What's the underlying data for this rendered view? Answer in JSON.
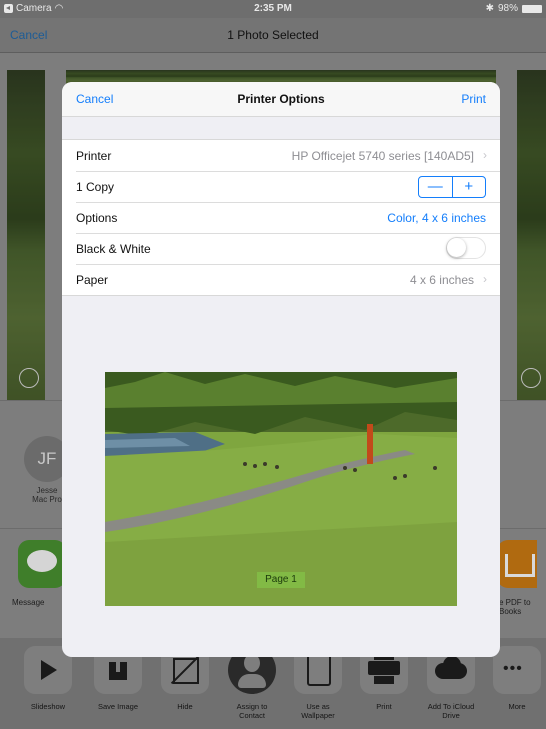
{
  "status_bar": {
    "app": "Camera",
    "time": "2:35 PM",
    "battery": "98%"
  },
  "nav": {
    "cancel": "Cancel",
    "title": "1 Photo Selected"
  },
  "contact": {
    "initials": "JF",
    "name_line1": "Jesse",
    "name_line2": "Mac Pro"
  },
  "share_apps": {
    "left_label": "Message",
    "right_label_line1": "e PDF to",
    "right_label_line2": "Books"
  },
  "actions": [
    {
      "icon": "play-icon",
      "label": "Slideshow"
    },
    {
      "icon": "download-icon",
      "label": "Save Image"
    },
    {
      "icon": "hide-icon",
      "label": "Hide"
    },
    {
      "icon": "contact-icon",
      "label_line1": "Assign to",
      "label_line2": "Contact"
    },
    {
      "icon": "ipad-icon",
      "label_line1": "Use as",
      "label_line2": "Wallpaper"
    },
    {
      "icon": "printer-icon",
      "label": "Print"
    },
    {
      "icon": "cloud-upload-icon",
      "label_line1": "Add To iCloud",
      "label_line2": "Drive"
    },
    {
      "icon": "more-icon",
      "label": "More"
    }
  ],
  "printer_options": {
    "cancel": "Cancel",
    "title": "Printer Options",
    "print": "Print",
    "rows": {
      "printer": {
        "label": "Printer",
        "value": "HP Officejet 5740 series [140AD5]"
      },
      "copies": {
        "label": "1 Copy",
        "minus": "—",
        "plus": "+"
      },
      "options": {
        "label": "Options",
        "value": "Color, 4 x 6 inches"
      },
      "black_white": {
        "label": "Black & White",
        "on": false
      },
      "paper": {
        "label": "Paper",
        "value": "4 x 6 inches"
      }
    },
    "preview": {
      "page_label": "Page 1"
    }
  },
  "colors": {
    "ios_blue": "#147efb",
    "dim_overlay": "#7d7d7d"
  }
}
